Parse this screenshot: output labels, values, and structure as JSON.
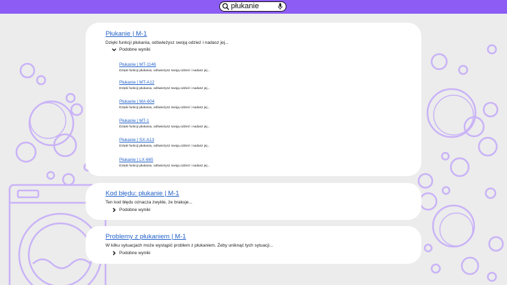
{
  "search": {
    "query": "płukanie"
  },
  "results": [
    {
      "title": "Płukanie | M-1",
      "description": "Dzięki funkcji płukania, odświeżysz swoją odzież i nadasz jej...",
      "more_label": "Podobne wyniki",
      "expanded": true,
      "related": [
        {
          "title": "Płukanie | MT-1146",
          "description": "Dzięki funkcji płukania, odświeżysz swoją odzież i nadasz jej..."
        },
        {
          "title": "Płukanie | MT-A12",
          "description": "Dzięki funkcji płukania, odświeżysz swoją odzież i nadasz jej..."
        },
        {
          "title": "Płukanie | MA-604",
          "description": "Dzięki funkcji płukania, odświeżysz swoją odzież i nadasz jej..."
        },
        {
          "title": "Płukanie | MT-1",
          "description": "Dzięki funkcji płukania, odświeżysz swoją odzież i nadasz jej..."
        },
        {
          "title": "Płukanie | SX-A13",
          "description": "Dzięki funkcji płukania, odświeżysz swoją odzież i nadasz jej..."
        },
        {
          "title": "Płukanie | LX-665",
          "description": "Dzięki funkcji płukania, odświeżysz swoją odzież i nadasz jej..."
        }
      ]
    },
    {
      "title": "Kod błędu: płukanie | M-1",
      "description": "Ten kod błędu oznacza zwykle, że brakuje...",
      "more_label": "Podobne wyniki",
      "expanded": false
    },
    {
      "title": "Problemy z płukaniem | M-1",
      "description": "W kilku sytuacjach może wystąpić problem z płukaniem. Żeby uniknąć tych sytuacji...",
      "more_label": "Podobne wyniki",
      "expanded": false
    }
  ],
  "colors": {
    "accent": "#8c5cf5",
    "link": "#2563c9",
    "bubble": "#c9b3f7",
    "background": "#ececec"
  },
  "icons": {
    "search": "search-icon",
    "mic": "microphone-icon",
    "expanded": "chevron-down-icon",
    "collapsed": "chevron-right-icon"
  }
}
